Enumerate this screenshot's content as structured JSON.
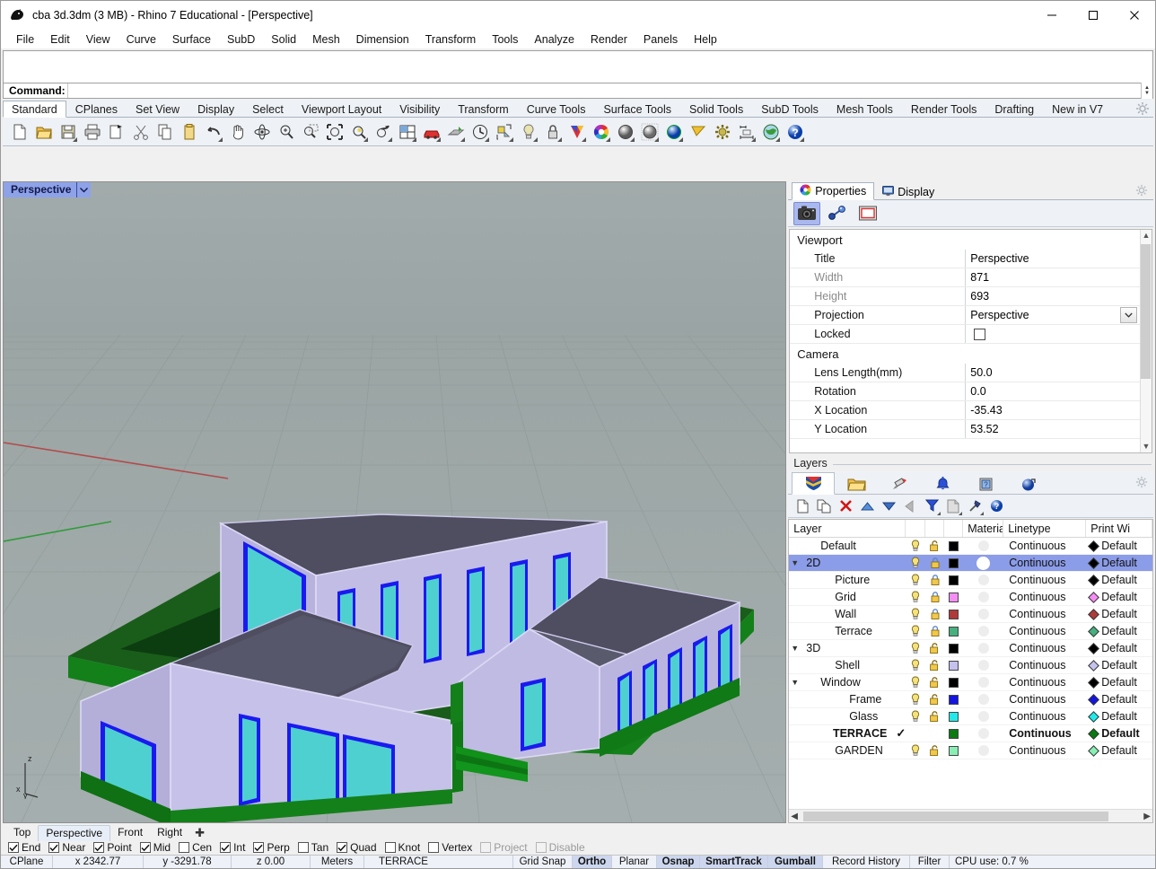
{
  "window": {
    "title": "cba 3d.3dm (3 MB) - Rhino 7 Educational - [Perspective]",
    "icon": "rhino-logo-icon",
    "minimize": "minimize-icon",
    "maximize": "maximize-icon",
    "close": "close-icon"
  },
  "menu": [
    "File",
    "Edit",
    "View",
    "Curve",
    "Surface",
    "SubD",
    "Solid",
    "Mesh",
    "Dimension",
    "Transform",
    "Tools",
    "Analyze",
    "Render",
    "Panels",
    "Help"
  ],
  "command": {
    "label": "Command:",
    "value": "",
    "placeholder": "",
    "history": ""
  },
  "toolbar_tabs": {
    "active": "Standard",
    "items": [
      "Standard",
      "CPlanes",
      "Set View",
      "Display",
      "Select",
      "Viewport Layout",
      "Visibility",
      "Transform",
      "Curve Tools",
      "Surface Tools",
      "Solid Tools",
      "SubD Tools",
      "Mesh Tools",
      "Render Tools",
      "Drafting",
      "New in V7"
    ]
  },
  "standard_toolbar": [
    {
      "name": "new-file-icon",
      "flyout": false
    },
    {
      "name": "open-file-icon",
      "flyout": false
    },
    {
      "name": "save-file-icon",
      "flyout": true
    },
    {
      "name": "print-icon",
      "flyout": false
    },
    {
      "name": "copy-to-clipboard-icon",
      "flyout": false
    },
    {
      "name": "cut-icon",
      "flyout": false
    },
    {
      "name": "copy-icon",
      "flyout": false
    },
    {
      "name": "paste-icon",
      "flyout": false
    },
    {
      "name": "undo-icon",
      "flyout": true
    },
    {
      "name": "pan-icon",
      "flyout": false
    },
    {
      "name": "rotate-view-icon",
      "flyout": false
    },
    {
      "name": "zoom-in-out-icon",
      "flyout": false
    },
    {
      "name": "zoom-dynamic-icon",
      "flyout": false
    },
    {
      "name": "zoom-extents-icon",
      "flyout": true
    },
    {
      "name": "zoom-selected-icon",
      "flyout": false
    },
    {
      "name": "undo-view-change-icon",
      "flyout": true
    },
    {
      "name": "viewport-layout-icon",
      "flyout": true
    },
    {
      "name": "named-view-car-icon",
      "flyout": true
    },
    {
      "name": "cplane-icon",
      "flyout": true
    },
    {
      "name": "history-icon",
      "flyout": true
    },
    {
      "name": "group-icon",
      "flyout": true
    },
    {
      "name": "light-icon",
      "flyout": true
    },
    {
      "name": "lock-icon",
      "flyout": true
    },
    {
      "name": "layer-color-icon",
      "flyout": true
    },
    {
      "name": "color-wheel-icon",
      "flyout": true
    },
    {
      "name": "shade-icon",
      "flyout": true
    },
    {
      "name": "render-preview-icon",
      "flyout": true
    },
    {
      "name": "render-icon",
      "flyout": true
    },
    {
      "name": "clipping-plane-icon",
      "flyout": false
    },
    {
      "name": "options-gear-icon",
      "flyout": false
    },
    {
      "name": "dimension-icon",
      "flyout": true
    },
    {
      "name": "earth-icon",
      "flyout": true
    },
    {
      "name": "help-icon",
      "flyout": true
    }
  ],
  "viewport": {
    "label": "Perspective",
    "dropdown_icon": "chevron-down-icon",
    "axis_labels": {
      "z": "z",
      "x": "x",
      "y": "y"
    },
    "background_top": "#9ba4a4",
    "background_ground": "#9aa3a3"
  },
  "properties_panel": {
    "tabs": [
      {
        "label": "Properties",
        "icon": "properties-color-wheel-icon",
        "active": true
      },
      {
        "label": "Display",
        "icon": "display-monitor-icon",
        "active": false
      }
    ],
    "gear_icon": "panel-options-gear-icon",
    "toolbuttons": [
      {
        "name": "camera-properties-icon",
        "selected": true
      },
      {
        "name": "object-properties-icon",
        "selected": false
      },
      {
        "name": "view-properties-icon",
        "selected": false
      }
    ],
    "sections": [
      {
        "title": "Viewport",
        "rows": [
          {
            "key": "Title",
            "value": "Perspective",
            "type": "text",
            "dim": false
          },
          {
            "key": "Width",
            "value": "871",
            "type": "text",
            "dim": true
          },
          {
            "key": "Height",
            "value": "693",
            "type": "text",
            "dim": true
          },
          {
            "key": "Projection",
            "value": "Perspective",
            "type": "combo",
            "dim": false
          },
          {
            "key": "Locked",
            "value": "",
            "type": "checkbox",
            "dim": false,
            "checked": false
          }
        ]
      },
      {
        "title": "Camera",
        "rows": [
          {
            "key": "Lens Length(mm)",
            "value": "50.0",
            "type": "text",
            "dim": false
          },
          {
            "key": "Rotation",
            "value": "0.0",
            "type": "text",
            "dim": false
          },
          {
            "key": "X Location",
            "value": "-35.43",
            "type": "text",
            "dim": false
          },
          {
            "key": "Y Location",
            "value": "53.52",
            "type": "text",
            "dim": false
          }
        ]
      }
    ]
  },
  "layers_panel": {
    "group_label": "Layers",
    "tabs": [
      {
        "name": "layers-tab-icon",
        "active": true
      },
      {
        "name": "folder-tab-icon",
        "active": false
      },
      {
        "name": "linetype-tab-icon",
        "active": false
      },
      {
        "name": "notification-bell-tab-icon",
        "active": false
      },
      {
        "name": "named-views-tab-icon",
        "active": false
      },
      {
        "name": "environment-globe-tab-icon",
        "active": false
      }
    ],
    "gear_icon": "layers-options-gear-icon",
    "tools": [
      {
        "name": "new-layer-icon",
        "flyout": false
      },
      {
        "name": "new-sublayer-icon",
        "flyout": false
      },
      {
        "name": "delete-layer-icon",
        "flyout": false
      },
      {
        "name": "move-layer-up-icon",
        "flyout": false
      },
      {
        "name": "move-layer-down-icon",
        "flyout": false
      },
      {
        "name": "back-arrow-icon",
        "flyout": false
      },
      {
        "name": "filter-icon",
        "flyout": true
      },
      {
        "name": "layer-properties-icon",
        "flyout": true
      },
      {
        "name": "layer-tools-hammer-icon",
        "flyout": true
      },
      {
        "name": "layers-help-icon",
        "flyout": false
      }
    ],
    "columns": [
      "Layer",
      "",
      "",
      "",
      "",
      "Material",
      "Linetype",
      "",
      "Print Wi"
    ],
    "rows": [
      {
        "name": "Default",
        "indent": 1,
        "expander": "",
        "on": true,
        "locked": false,
        "color": "#000000",
        "material": false,
        "linetype": "Continuous",
        "printwidth": "Default",
        "pwcolor": "#000000",
        "selected": false,
        "bold": false,
        "current": false
      },
      {
        "name": "2D",
        "indent": 0,
        "expander": "expanded",
        "on": true,
        "locked": true,
        "color": "#000000",
        "material": true,
        "linetype": "Continuous",
        "printwidth": "Default",
        "pwcolor": "#000000",
        "selected": true,
        "bold": false,
        "current": false
      },
      {
        "name": "Picture",
        "indent": 2,
        "expander": "",
        "on": true,
        "locked": true,
        "color": "#000000",
        "material": false,
        "linetype": "Continuous",
        "printwidth": "Default",
        "pwcolor": "#000000",
        "selected": false,
        "bold": false,
        "current": false
      },
      {
        "name": "Grid",
        "indent": 2,
        "expander": "",
        "on": true,
        "locked": true,
        "color": "#f48ef4",
        "material": false,
        "linetype": "Continuous",
        "printwidth": "Default",
        "pwcolor": "#f48ef4",
        "selected": false,
        "bold": false,
        "current": false
      },
      {
        "name": "Wall",
        "indent": 2,
        "expander": "",
        "on": true,
        "locked": true,
        "color": "#b03a3a",
        "material": false,
        "linetype": "Continuous",
        "printwidth": "Default",
        "pwcolor": "#b03a3a",
        "selected": false,
        "bold": false,
        "current": false
      },
      {
        "name": "Terrace",
        "indent": 2,
        "expander": "",
        "on": true,
        "locked": true,
        "color": "#47b07f",
        "material": false,
        "linetype": "Continuous",
        "printwidth": "Default",
        "pwcolor": "#47b07f",
        "selected": false,
        "bold": false,
        "current": false
      },
      {
        "name": "3D",
        "indent": 0,
        "expander": "expanded",
        "on": true,
        "locked": false,
        "color": "#000000",
        "material": false,
        "linetype": "Continuous",
        "printwidth": "Default",
        "pwcolor": "#000000",
        "selected": false,
        "bold": false,
        "current": false
      },
      {
        "name": "Shell",
        "indent": 2,
        "expander": "",
        "on": true,
        "locked": false,
        "color": "#c5c2ee",
        "material": false,
        "linetype": "Continuous",
        "printwidth": "Default",
        "pwcolor": "#c5c2ee",
        "selected": false,
        "bold": false,
        "current": false
      },
      {
        "name": "Window",
        "indent": 1,
        "expander": "expanded",
        "on": true,
        "locked": false,
        "color": "#000000",
        "material": false,
        "linetype": "Continuous",
        "printwidth": "Default",
        "pwcolor": "#000000",
        "selected": false,
        "bold": false,
        "current": false
      },
      {
        "name": "Frame",
        "indent": 3,
        "expander": "",
        "on": true,
        "locked": false,
        "color": "#1414e0",
        "material": false,
        "linetype": "Continuous",
        "printwidth": "Default",
        "pwcolor": "#1414e0",
        "selected": false,
        "bold": false,
        "current": false
      },
      {
        "name": "Glass",
        "indent": 3,
        "expander": "",
        "on": true,
        "locked": false,
        "color": "#22eaea",
        "material": false,
        "linetype": "Continuous",
        "printwidth": "Default",
        "pwcolor": "#22eaea",
        "selected": false,
        "bold": false,
        "current": false
      },
      {
        "name": "TERRACE",
        "indent": 2,
        "expander": "",
        "on": null,
        "locked": null,
        "color": "#0a7a12",
        "material": false,
        "linetype": "Continuous",
        "printwidth": "Default",
        "pwcolor": "#0a7a12",
        "selected": false,
        "bold": true,
        "current": true
      },
      {
        "name": "GARDEN",
        "indent": 2,
        "expander": "",
        "on": true,
        "locked": false,
        "color": "#8aeeb4",
        "material": false,
        "linetype": "Continuous",
        "printwidth": "Default",
        "pwcolor": "#8aeeb4",
        "selected": false,
        "bold": false,
        "current": false
      }
    ]
  },
  "viewport_tabs": {
    "items": [
      "Top",
      "Perspective",
      "Front",
      "Right"
    ],
    "active": "Perspective",
    "add_label": "+"
  },
  "osnaps": [
    {
      "label": "End",
      "checked": true,
      "disabled": false
    },
    {
      "label": "Near",
      "checked": true,
      "disabled": false
    },
    {
      "label": "Point",
      "checked": true,
      "disabled": false
    },
    {
      "label": "Mid",
      "checked": true,
      "disabled": false
    },
    {
      "label": "Cen",
      "checked": false,
      "disabled": false
    },
    {
      "label": "Int",
      "checked": true,
      "disabled": false
    },
    {
      "label": "Perp",
      "checked": true,
      "disabled": false
    },
    {
      "label": "Tan",
      "checked": false,
      "disabled": false
    },
    {
      "label": "Quad",
      "checked": true,
      "disabled": false
    },
    {
      "label": "Knot",
      "checked": false,
      "disabled": false
    },
    {
      "label": "Vertex",
      "checked": false,
      "disabled": false
    },
    {
      "label": "Project",
      "checked": false,
      "disabled": true
    },
    {
      "label": "Disable",
      "checked": false,
      "disabled": true
    }
  ],
  "statusbar": {
    "cplane": "CPlane",
    "x": "x 2342.77",
    "y": "y -3291.78",
    "z": "z 0.00",
    "units": "Meters",
    "layer": "TERRACE",
    "toggles": [
      {
        "label": "Grid Snap",
        "on": false
      },
      {
        "label": "Ortho",
        "on": true
      },
      {
        "label": "Planar",
        "on": false
      },
      {
        "label": "Osnap",
        "on": true
      },
      {
        "label": "SmartTrack",
        "on": true
      },
      {
        "label": "Gumball",
        "on": true
      },
      {
        "label": "Record History",
        "on": false
      },
      {
        "label": "Filter",
        "on": false
      }
    ],
    "cpu": "CPU use: 0.7 %"
  }
}
